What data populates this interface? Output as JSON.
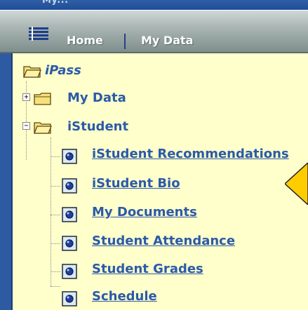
{
  "header": {
    "title_fragment": "My...",
    "nav": [
      {
        "label": "Home"
      },
      {
        "label": "My Data"
      }
    ]
  },
  "tree": {
    "root": {
      "label": "iPass"
    },
    "folders": [
      {
        "label": "My Data",
        "expander": "+"
      },
      {
        "label": "iStudent",
        "expander": "−"
      }
    ],
    "items": [
      {
        "label": "iStudent Recommendations"
      },
      {
        "label": "iStudent Bio"
      },
      {
        "label": "My Documents"
      },
      {
        "label": "Student Attendance"
      },
      {
        "label": "Student Grades"
      },
      {
        "label": "Schedule"
      }
    ]
  },
  "colors": {
    "link": "#2b5aa8",
    "panel_background": "#ffffcc",
    "callout": "#ffcc00"
  }
}
